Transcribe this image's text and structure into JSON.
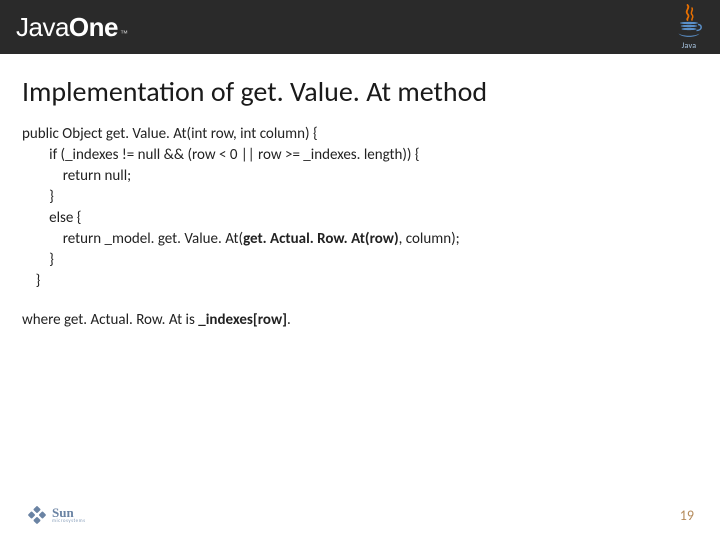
{
  "header": {
    "brand_part1": "Java",
    "brand_part2": "One",
    "trademark": "™",
    "java_label": "Java"
  },
  "slide": {
    "title": "Implementation of get. Value. At method",
    "code_lines": [
      "public Object get. Value. At(int row, int column) {",
      "        if (_indexes != null && (row < 0 || row >= _indexes. length)) {",
      "            return null;",
      "        }",
      "        else {",
      "            return _model. get. Value. At(<b>get. Actual. Row. At(row)</b>, column);",
      "        }",
      "    }"
    ],
    "where_prefix": "where get. Actual. Row. At is ",
    "where_bold": "_indexes[row]",
    "where_suffix": "."
  },
  "footer": {
    "sun_main": "Sun",
    "sun_sub": "microsystems",
    "page": "19"
  }
}
